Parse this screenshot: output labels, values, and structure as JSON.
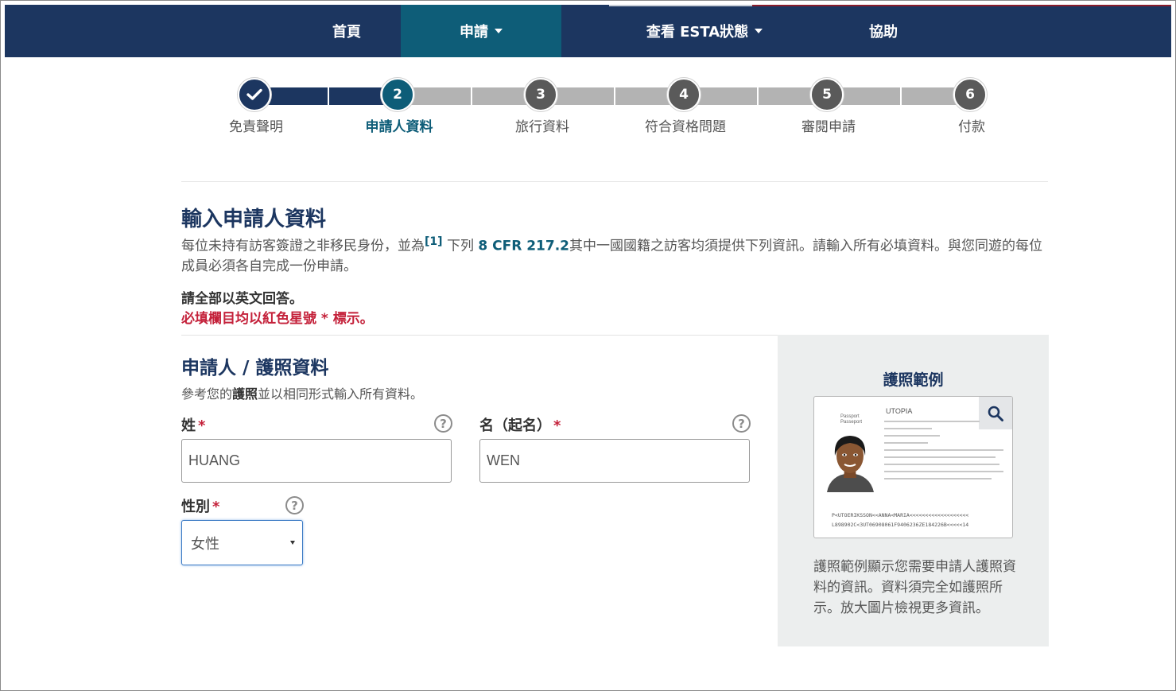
{
  "nav": {
    "items": [
      {
        "label": "首頁"
      },
      {
        "label": "申請"
      },
      {
        "label": "查看 ESTA狀態"
      },
      {
        "label": "協助"
      }
    ]
  },
  "stepper": {
    "steps": [
      {
        "number": "",
        "label": "免責聲明",
        "state": "done"
      },
      {
        "number": "2",
        "label": "申請人資料",
        "state": "current"
      },
      {
        "number": "3",
        "label": "旅行資料",
        "state": "pending"
      },
      {
        "number": "4",
        "label": "符合資格問題",
        "state": "pending"
      },
      {
        "number": "5",
        "label": "審閱申請",
        "state": "pending"
      },
      {
        "number": "6",
        "label": "付款",
        "state": "pending"
      }
    ]
  },
  "main": {
    "title": "輸入申請人資料",
    "intro_part1": "每位未持有訪客簽證之非移民身份，並為",
    "intro_footnote": "[1]",
    "intro_part2": " 下列 ",
    "intro_cfr": "8 CFR 217.2",
    "intro_part3": "其中一國國籍之訪客均須提供下列資訊。請輸入所有必填資料。與您同遊的每位成員必須各自完成一份申請。",
    "note_english": "請全部以英文回答。",
    "note_required": "必填欄目均以紅色星號 * 標示。"
  },
  "section": {
    "title": "申請人 / 護照資料",
    "desc_part1": "參考您的",
    "desc_bold": "護照",
    "desc_part2": "並以相同形式輸入所有資料。"
  },
  "form": {
    "surname": {
      "label": "姓",
      "required_mark": "*",
      "value": "HUANG"
    },
    "given_name": {
      "label": "名（起名）",
      "required_mark": "*",
      "value": "WEN"
    },
    "gender": {
      "label": "性別",
      "required_mark": "*",
      "selected": "女性"
    },
    "help_glyph": "?"
  },
  "sidebar": {
    "title": "護照範例",
    "passport": {
      "country": "UTOPIA",
      "doc_type": "Passport\nPasseport",
      "mrz_line1": "P<UTOERIKSSON<<ANNA<MARIA<<<<<<<<<<<<<<<<<<<",
      "mrz_line2": "L898902C<3UT06908061F9406236ZE184226B<<<<<14"
    },
    "description": "護照範例顯示您需要申請人護照資料的資訊。資料須完全如護照所示。放大圖片檢視更多資訊。"
  },
  "colors": {
    "nav_bg": "#1c3660",
    "nav_active": "#0e5d78",
    "required_red": "#c4213a",
    "step_pending": "#5a5a5a"
  },
  "icons": {
    "step1": "checkmark-icon",
    "zoom": "magnifier-icon",
    "help": "question-circle-icon",
    "dropdown": "caret-down-icon"
  }
}
